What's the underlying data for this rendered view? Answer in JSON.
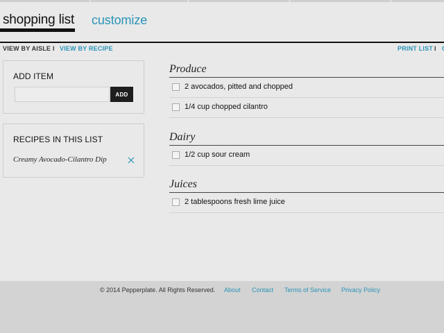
{
  "tabs": {
    "active": "shopping list",
    "customize": "customize"
  },
  "view": {
    "by_aisle": "VIEW BY AISLE",
    "separator": "I",
    "by_recipe": "VIEW BY RECIPE",
    "print_list": "PRINT LIST",
    "print_separator": "I",
    "print_more": "C"
  },
  "add_item": {
    "title": "ADD ITEM",
    "input_value": "",
    "button_label": "ADD"
  },
  "recipes_panel": {
    "title": "RECIPES IN THIS LIST",
    "recipes": [
      {
        "name": "Creamy Avocado-Cilantro Dip",
        "remove_icon": "close-icon"
      }
    ]
  },
  "sections": [
    {
      "name": "Produce",
      "items": [
        "2 avocados, pitted and chopped",
        "1/4 cup chopped cilantro"
      ]
    },
    {
      "name": "Dairy",
      "items": [
        "1/2 cup sour cream"
      ]
    },
    {
      "name": "Juices",
      "items": [
        "2 tablespoons fresh lime juice"
      ]
    }
  ],
  "footer": {
    "copyright": "© 2014 Pepperplate. All Rights Reserved.",
    "links": [
      "About",
      "Contact",
      "Terms of Service",
      "Privacy Policy"
    ]
  },
  "colors": {
    "accent": "#2a93b8",
    "text": "#222222",
    "background": "#e9e9e9",
    "footer_bg": "#d3d3d3",
    "button_bg": "#1e1e1e"
  }
}
